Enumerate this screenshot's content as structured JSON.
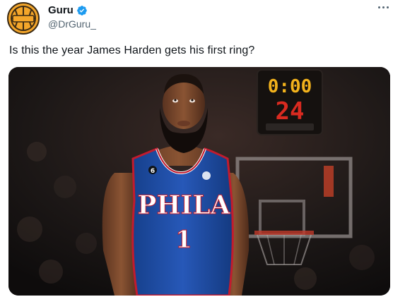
{
  "author": {
    "display_name": "Guru",
    "handle": "@DrGuru_",
    "verified": true,
    "avatar_icon": "basketball-logo-icon",
    "avatar_color": "#f4a62a"
  },
  "tweet": {
    "text": "Is this the year James Harden gets his first ring?"
  },
  "media": {
    "jersey_text": "PHILA",
    "jersey_number": "1",
    "jersey_patch_number": "6",
    "jersey_color": "#1d4fa8",
    "scoreboard_top": "0:00",
    "scoreboard_shot_clock": "24"
  },
  "colors": {
    "verified": "#1d9bf0",
    "secondary_text": "#536471"
  }
}
